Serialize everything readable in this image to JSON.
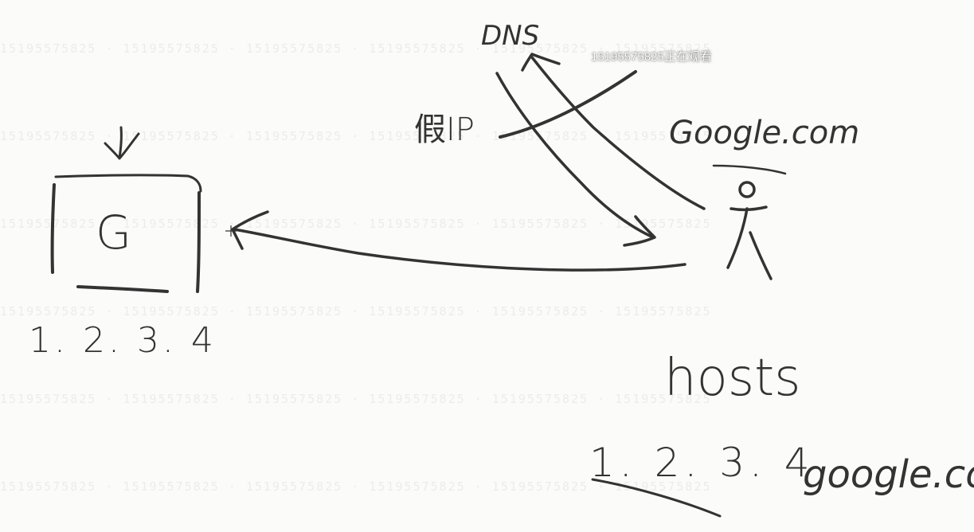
{
  "watermark": {
    "rows": [
      "15195575825  ·  15195575825  ·  15195575825  ·  15195575825  ·  15195575825  ·  15195575825",
      "15195575825  ·  15195575825  ·  15195575825  ·  15195575825  ·  15195575825  ·  15195575825",
      "15195575825  ·  15195575825  ·  15195575825  ·  15195575825  ·  15195575825  ·  15195575825",
      "15195575825  ·  15195575825  ·  15195575825  ·  15195575825  ·  15195575825  ·  15195575825",
      "15195575825  ·  15195575825  ·  15195575825  ·  15195575825  ·  15195575825  ·  15195575825",
      "15195575825  ·  15195575825  ·  15195575825  ·  15195575825  ·  15195575825  ·  15195575825"
    ]
  },
  "viewer_overlay": "15195575825正在观看",
  "diagram": {
    "dns_label": "DNS",
    "fake_ip_label": "假IP",
    "domain_label": "Google.com",
    "server_letter": "G",
    "server_ip": "1. 2. 3. 4",
    "hosts_label": "hosts",
    "hosts_ip": "1. 2. 3. 4",
    "hosts_domain": "google.com"
  },
  "colors": {
    "ink": "#333333",
    "background": "#fbfbfa",
    "watermark": "#ececec"
  }
}
